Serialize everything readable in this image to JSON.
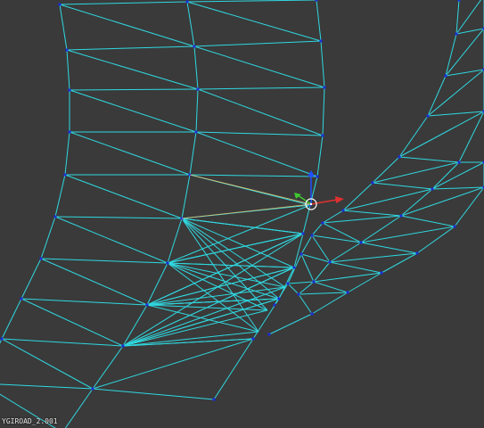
{
  "viewport": {
    "object_label": "YGIROAD_2.001",
    "background_color": "#3a3a3a",
    "wire_color": "#2fd8e0",
    "vertex_color": "#1a2dd8",
    "gizmo": {
      "x_axis_color": "#e03030",
      "y_axis_color": "#3fc830",
      "z_axis_color": "#2050ff",
      "guide_color": "#e0c070",
      "cursor_color": "#ffffff"
    }
  }
}
